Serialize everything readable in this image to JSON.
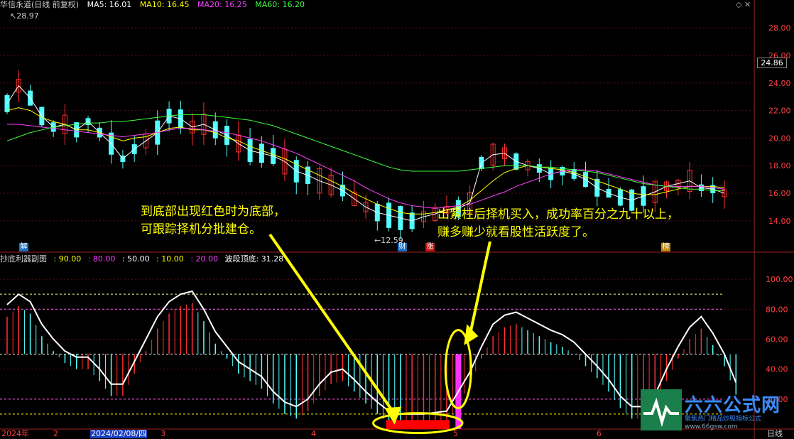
{
  "header": {
    "title": "华信永道(日线 前复权)",
    "ma5": "MA5: 16.01",
    "ma10": "MA10: 16.45",
    "ma20": "MA20: 16.25",
    "ma60": "MA60: 16.20"
  },
  "sub_header": {
    "title": "抄底利器副图",
    "v1": ": 90.00",
    "v2": ": 80.00",
    "v3": ": 50.00",
    "v4": ": 10.00",
    "v5": ": 20.00",
    "v6": "波段顶底: 31.28"
  },
  "annotations": {
    "left_line1": "到底部出现红色时为底部，",
    "left_line2": "可跟踪择机分批建仓。",
    "right_line1": "出紫柱后择机买入，成功率百分之九十以上，",
    "right_line2": "赚多赚少就看股性活跃度了。"
  },
  "markers": {
    "high": "28.97",
    "low": "12.59",
    "current_price": "24.86",
    "icon_jie": "解",
    "icon_cai": "财",
    "icon_zhang": "涨",
    "icon_bang": "榜"
  },
  "date_axis": {
    "d0": "2024年",
    "d1": "2",
    "d2": "2024/02/08/四",
    "d3": "3",
    "d4": "4",
    "d5": "5",
    "d6": "6",
    "period": "日线"
  },
  "watermark": {
    "brand": "六六公式网",
    "slogan": "聚焦热门精品炒股指标公式",
    "url": "www.66gsw.com"
  },
  "colors": {
    "up": "#ff3030",
    "down": "#54ffff",
    "ma5": "#ffffff",
    "ma10": "#ffff00",
    "ma20": "#ff40ff",
    "ma60": "#40ff40",
    "annotation": "#ffff00",
    "purple_bar": "#ff30ff"
  },
  "chart_data": [
    {
      "type": "line",
      "title": "华信永道(日线 前复权)",
      "ylim": [
        12.5,
        29.5
      ],
      "y_ticks": [
        14.0,
        16.0,
        18.0,
        20.0,
        22.0,
        24.0,
        26.0,
        28.0
      ],
      "grid": true,
      "series": [
        {
          "name": "MA5",
          "values": [
            22.5,
            23.8,
            22.9,
            21.6,
            20.8,
            21.0,
            20.6,
            21.2,
            20.4,
            19.6,
            18.5,
            19.2,
            19.8,
            20.4,
            21.6,
            21.4,
            20.8,
            21.0,
            20.6,
            20.2,
            19.6,
            19.1,
            18.9,
            18.7,
            18.3,
            17.6,
            17.3,
            16.9,
            16.6,
            16.2,
            15.6,
            15.0,
            14.6,
            14.4,
            14.2,
            14.0,
            14.3,
            14.5,
            14.8,
            14.9,
            15.3,
            18.2,
            18.8,
            18.9,
            18.3,
            18.0,
            17.8,
            17.4,
            17.6,
            17.4,
            17.0,
            16.4,
            16.0,
            15.7,
            15.5,
            15.8,
            16.1,
            16.5,
            16.7,
            16.9,
            16.4,
            16.3,
            16.0
          ]
        },
        {
          "name": "MA10",
          "values": [
            22.0,
            22.2,
            22.0,
            21.5,
            21.2,
            21.0,
            20.6,
            20.6,
            20.4,
            20.1,
            19.8,
            20.0,
            20.1,
            20.4,
            20.7,
            20.8,
            20.6,
            20.6,
            20.4,
            20.0,
            19.8,
            19.4,
            19.1,
            18.8,
            18.5,
            18.1,
            17.7,
            17.3,
            16.9,
            16.5,
            16.0,
            15.6,
            15.2,
            14.9,
            14.6,
            14.5,
            14.5,
            14.6,
            14.8,
            15.0,
            15.5,
            16.2,
            16.9,
            17.5,
            17.8,
            18.0,
            17.9,
            17.8,
            17.7,
            17.5,
            17.2,
            16.9,
            16.6,
            16.3,
            16.0,
            15.9,
            15.9,
            16.1,
            16.3,
            16.5,
            16.5,
            16.5,
            16.4
          ]
        },
        {
          "name": "MA20",
          "values": [
            21.0,
            21.0,
            20.9,
            20.8,
            20.7,
            20.6,
            20.5,
            20.4,
            20.3,
            20.2,
            20.1,
            20.2,
            20.3,
            20.4,
            20.6,
            20.7,
            20.7,
            20.6,
            20.5,
            20.4,
            20.2,
            20.0,
            19.8,
            19.5,
            19.2,
            18.9,
            18.5,
            18.1,
            17.7,
            17.3,
            16.9,
            16.4,
            16.0,
            15.6,
            15.3,
            15.1,
            15.0,
            14.9,
            15.0,
            15.1,
            15.2,
            15.5,
            15.8,
            16.1,
            16.5,
            16.8,
            17.1,
            17.4,
            17.6,
            17.7,
            17.7,
            17.6,
            17.4,
            17.2,
            17.0,
            16.8,
            16.6,
            16.5,
            16.5,
            16.5,
            16.5,
            16.4,
            16.3
          ]
        },
        {
          "name": "MA60",
          "values": [
            19.8,
            20.1,
            20.4,
            20.6,
            20.8,
            20.9,
            21.0,
            21.1,
            21.1,
            21.2,
            21.2,
            21.3,
            21.4,
            21.5,
            21.6,
            21.7,
            21.7,
            21.7,
            21.6,
            21.5,
            21.4,
            21.3,
            21.1,
            20.9,
            20.6,
            20.3,
            20.0,
            19.7,
            19.4,
            19.1,
            18.8,
            18.5,
            18.2,
            17.9,
            17.7,
            17.6,
            17.6,
            17.6,
            17.6,
            17.6,
            17.7,
            17.8,
            17.9,
            18.0,
            18.0,
            18.0,
            17.9,
            17.9,
            17.8,
            17.7,
            17.6,
            17.5,
            17.3,
            17.1,
            16.9,
            16.7,
            16.6,
            16.5,
            16.4,
            16.3,
            16.3,
            16.2,
            16.2
          ]
        }
      ],
      "annotations": {
        "high": "28.97",
        "low": "12.59",
        "current": "24.86"
      }
    },
    {
      "type": "bar",
      "title": "抄底利器副图",
      "ylim": [
        0,
        110
      ],
      "y_ticks": [
        20.0,
        40.0,
        60.0,
        80.0,
        100.0
      ],
      "reference_lines": [
        90,
        80,
        50,
        20,
        10
      ],
      "series": [
        {
          "name": "波段顶底",
          "values": [
            83,
            90,
            85,
            70,
            60,
            52,
            48,
            48,
            40,
            30,
            30,
            45,
            60,
            75,
            85,
            90,
            92,
            80,
            65,
            55,
            45,
            40,
            35,
            25,
            18,
            15,
            20,
            30,
            38,
            40,
            33,
            25,
            18,
            12,
            10,
            10,
            10,
            11,
            12,
            25,
            38,
            55,
            70,
            76,
            78,
            74,
            70,
            66,
            63,
            58,
            50,
            42,
            33,
            22,
            15,
            15,
            23,
            40,
            55,
            68,
            75,
            64,
            50,
            31
          ]
        }
      ],
      "signals": {
        "bottom_red_zone": [
          33,
          38
        ],
        "purple_bar_index": 39
      }
    }
  ]
}
